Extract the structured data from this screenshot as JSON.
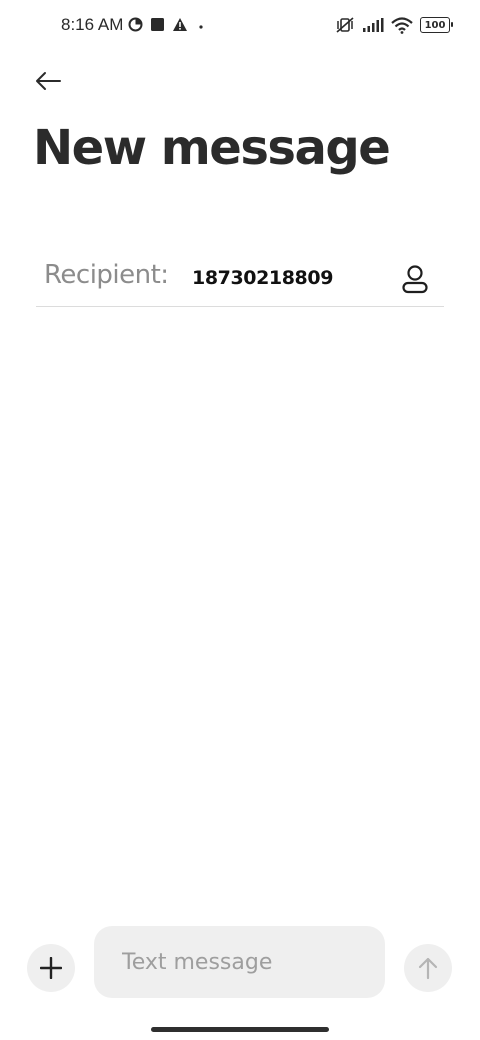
{
  "status_bar": {
    "time": "8:16 AM",
    "left_icons": [
      "data-saver-icon",
      "square-notification-icon",
      "warning-icon",
      "dot-icon"
    ],
    "right_icons": [
      "vibrate-off-icon",
      "signal-icon",
      "wifi-icon",
      "battery-icon"
    ],
    "battery": "100"
  },
  "header": {
    "back_icon": "arrow-left-icon",
    "title": "New message"
  },
  "recipient": {
    "label": "Recipient:",
    "value": "18730218809",
    "contact_icon": "person-icon"
  },
  "composer": {
    "add_icon": "plus-icon",
    "placeholder": "Text message",
    "send_icon": "arrow-up-icon"
  },
  "colors": {
    "background": "#ffffff",
    "title": "#2b2b2b",
    "label": "#8c8c8c",
    "input_bg": "#efefef",
    "placeholder": "#9e9e9e"
  }
}
